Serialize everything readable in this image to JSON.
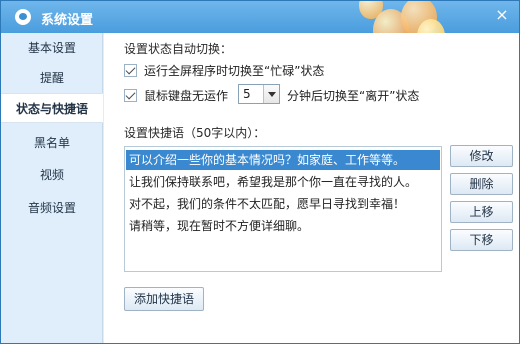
{
  "window": {
    "title": "系统设置",
    "close_symbol": "×",
    "accent": "#4a9ddd",
    "icons": [
      "app-icon",
      "close-icon",
      "balloons-decoration",
      "checkbox-icon",
      "dropdown-arrow-icon"
    ]
  },
  "sidebar": {
    "items": [
      {
        "label": "基本设置"
      },
      {
        "label": "提醒"
      },
      {
        "label": "状态与快捷语"
      },
      {
        "label": "黑名单"
      },
      {
        "label": "视频"
      },
      {
        "label": "音频设置"
      }
    ]
  },
  "status": {
    "section_title": "设置状态自动切换：",
    "fullscreen_label": "运行全屏程序时切换至“忙碌”状态",
    "idle_label": "鼠标键盘无运作",
    "minutes": "5",
    "after_label": "分钟后切换至“离开”状态"
  },
  "quick": {
    "section_title": "设置快捷语（50字以内）：",
    "items": [
      "可以介绍一些你的基本情况吗？如家庭、工作等等。",
      "让我们保持联系吧，希望我是那个你一直在寻找的人。",
      "对不起，我们的条件不太匹配，愿早日寻找到幸福！",
      "请稍等，现在暂时不方便详细聊。"
    ],
    "buttons": {
      "edit": "修改",
      "delete": "删除",
      "up": "上移",
      "down": "下移"
    },
    "add_button": "添加快捷语"
  }
}
